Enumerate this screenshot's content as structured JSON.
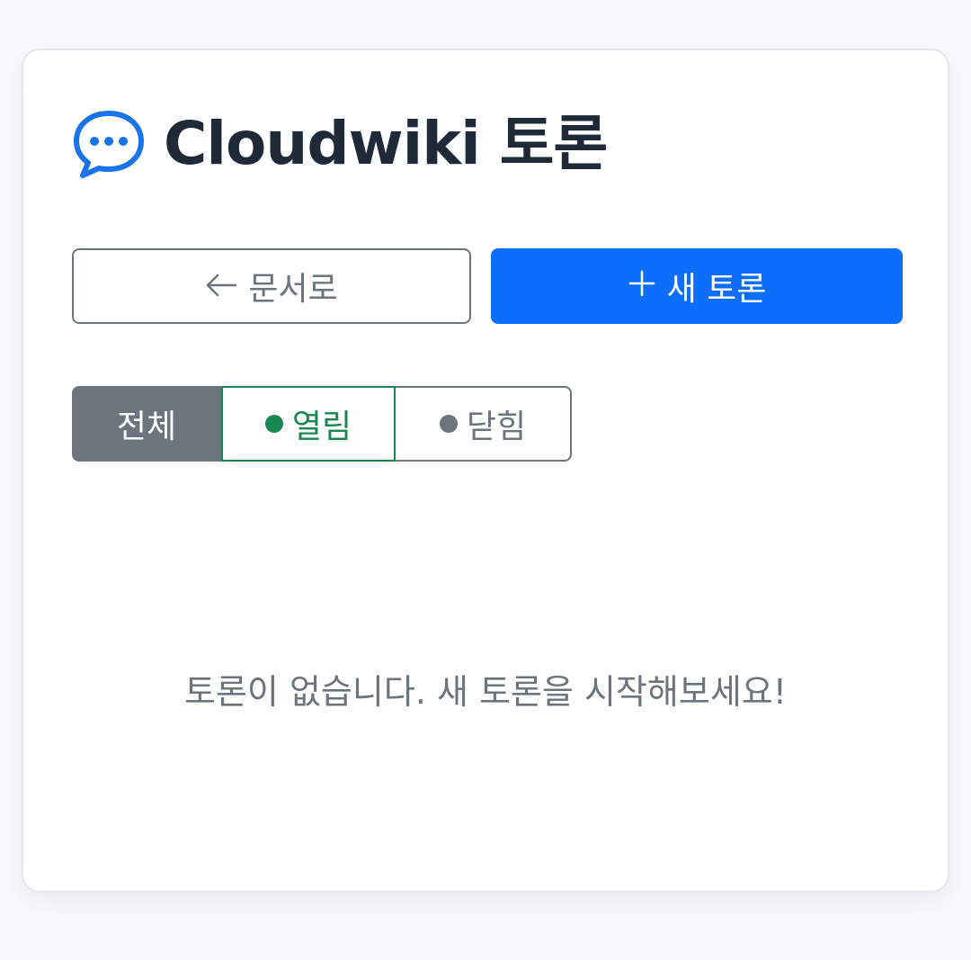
{
  "header": {
    "title": "Cloudwiki 토론",
    "icon": "chat-bubble-dots-icon"
  },
  "actions": {
    "back_label": "문서로",
    "back_icon": "arrow-left-icon",
    "new_label": "새 토론",
    "new_icon": "plus-icon"
  },
  "filters": {
    "all_label": "전체",
    "open_label": "열림",
    "closed_label": "닫힘"
  },
  "empty_message": "토론이 없습니다. 새 토론을 시작해보세요!",
  "colors": {
    "primary": "#0d6efd",
    "secondary": "#6c757d",
    "success": "#198754",
    "title": "#1f2937"
  }
}
